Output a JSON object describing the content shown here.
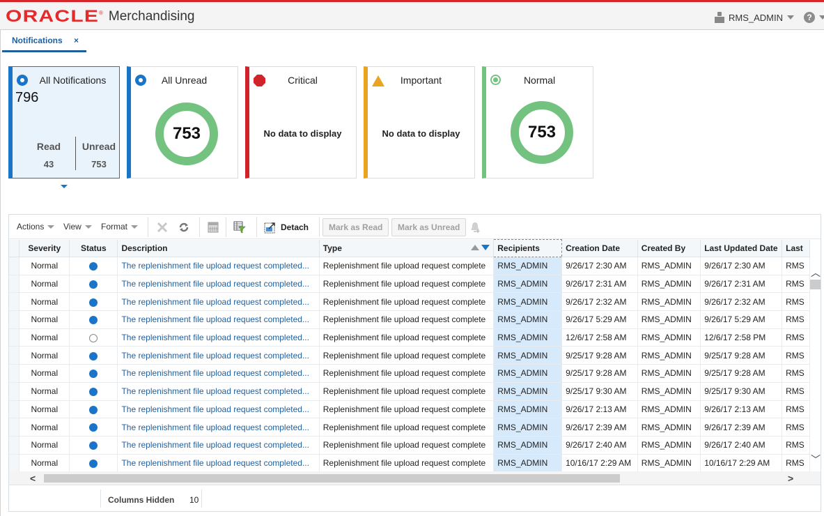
{
  "header": {
    "brand": "ORACLE",
    "brand_mark": "®",
    "app_name": "Merchandising",
    "user": "RMS_ADMIN",
    "help_glyph": "?",
    "accent_color": "#d7262b"
  },
  "tabs": [
    {
      "label": "Notifications",
      "close_glyph": "×",
      "active": true
    }
  ],
  "tiles": {
    "all": {
      "title": "All Notifications",
      "count": "796",
      "read_label": "Read",
      "read_value": "43",
      "unread_label": "Unread",
      "unread_value": "753",
      "icon": "radio-selected-icon",
      "color": "#1a74c8"
    },
    "unread": {
      "title": "All Unread",
      "value": "753",
      "icon": "radio-selected-icon",
      "color": "#1a74c8"
    },
    "critical": {
      "title": "Critical",
      "message": "No data to display",
      "icon": "critical-octagon-icon",
      "color": "#d1232a"
    },
    "important": {
      "title": "Important",
      "message": "No data to display",
      "icon": "warning-triangle-icon",
      "color": "#eba421"
    },
    "normal": {
      "title": "Normal",
      "value": "753",
      "icon": "normal-circle-icon",
      "color": "#74c27f"
    }
  },
  "toolbar": {
    "actions": "Actions",
    "view": "View",
    "format": "Format",
    "detach": "Detach",
    "mark_read": "Mark as Read",
    "mark_unread": "Mark as Unread"
  },
  "table": {
    "columns": [
      "Severity",
      "Status",
      "Description",
      "Type",
      "Recipients",
      "Creation Date",
      "Created By",
      "Last Updated Date",
      "Last"
    ],
    "sorted_column": "Type",
    "rows": [
      {
        "severity": "Normal",
        "status": "unread",
        "description": "The replenishment file upload request completed...",
        "type": "Replenishment file upload request complete",
        "recipients": "RMS_ADMIN",
        "created": "9/26/17 2:30 AM",
        "created_by": "RMS_ADMIN",
        "updated": "9/26/17 2:30 AM",
        "last": "RMS"
      },
      {
        "severity": "Normal",
        "status": "unread",
        "description": "The replenishment file upload request completed...",
        "type": "Replenishment file upload request complete",
        "recipients": "RMS_ADMIN",
        "created": "9/26/17 2:31 AM",
        "created_by": "RMS_ADMIN",
        "updated": "9/26/17 2:31 AM",
        "last": "RMS"
      },
      {
        "severity": "Normal",
        "status": "unread",
        "description": "The replenishment file upload request completed...",
        "type": "Replenishment file upload request complete",
        "recipients": "RMS_ADMIN",
        "created": "9/26/17 2:32 AM",
        "created_by": "RMS_ADMIN",
        "updated": "9/26/17 2:32 AM",
        "last": "RMS"
      },
      {
        "severity": "Normal",
        "status": "unread",
        "description": "The replenishment file upload request completed...",
        "type": "Replenishment file upload request complete",
        "recipients": "RMS_ADMIN",
        "created": "9/26/17 5:29 AM",
        "created_by": "RMS_ADMIN",
        "updated": "9/26/17 5:29 AM",
        "last": "RMS"
      },
      {
        "severity": "Normal",
        "status": "read",
        "description": "The replenishment file upload request completed...",
        "type": "Replenishment file upload request complete",
        "recipients": "RMS_ADMIN",
        "created": "12/6/17 2:58 AM",
        "created_by": "RMS_ADMIN",
        "updated": "12/6/17 2:58 PM",
        "last": "RMS"
      },
      {
        "severity": "Normal",
        "status": "unread",
        "description": "The replenishment file upload request completed...",
        "type": "Replenishment file upload request complete",
        "recipients": "RMS_ADMIN",
        "created": "9/25/17 9:28 AM",
        "created_by": "RMS_ADMIN",
        "updated": "9/25/17 9:28 AM",
        "last": "RMS"
      },
      {
        "severity": "Normal",
        "status": "unread",
        "description": "The replenishment file upload request completed...",
        "type": "Replenishment file upload request complete",
        "recipients": "RMS_ADMIN",
        "created": "9/25/17 9:28 AM",
        "created_by": "RMS_ADMIN",
        "updated": "9/25/17 9:28 AM",
        "last": "RMS"
      },
      {
        "severity": "Normal",
        "status": "unread",
        "description": "The replenishment file upload request completed...",
        "type": "Replenishment file upload request complete",
        "recipients": "RMS_ADMIN",
        "created": "9/25/17 9:30 AM",
        "created_by": "RMS_ADMIN",
        "updated": "9/25/17 9:30 AM",
        "last": "RMS"
      },
      {
        "severity": "Normal",
        "status": "unread",
        "description": "The replenishment file upload request completed...",
        "type": "Replenishment file upload request complete",
        "recipients": "RMS_ADMIN",
        "created": "9/26/17 2:13 AM",
        "created_by": "RMS_ADMIN",
        "updated": "9/26/17 2:13 AM",
        "last": "RMS"
      },
      {
        "severity": "Normal",
        "status": "unread",
        "description": "The replenishment file upload request completed...",
        "type": "Replenishment file upload request complete",
        "recipients": "RMS_ADMIN",
        "created": "9/26/17 2:39 AM",
        "created_by": "RMS_ADMIN",
        "updated": "9/26/17 2:39 AM",
        "last": "RMS"
      },
      {
        "severity": "Normal",
        "status": "unread",
        "description": "The replenishment file upload request completed...",
        "type": "Replenishment file upload request complete",
        "recipients": "RMS_ADMIN",
        "created": "9/26/17 2:40 AM",
        "created_by": "RMS_ADMIN",
        "updated": "9/26/17 2:40 AM",
        "last": "RMS"
      },
      {
        "severity": "Normal",
        "status": "unread",
        "description": "The replenishment file upload request completed...",
        "type": "Replenishment file upload request complete",
        "recipients": "RMS_ADMIN",
        "created": "10/16/17 2:29 AM",
        "created_by": "RMS_ADMIN",
        "updated": "10/16/17 2:29 AM",
        "last": "RMS"
      }
    ]
  },
  "footer": {
    "columns_hidden_label": "Columns Hidden",
    "columns_hidden_value": "10"
  }
}
